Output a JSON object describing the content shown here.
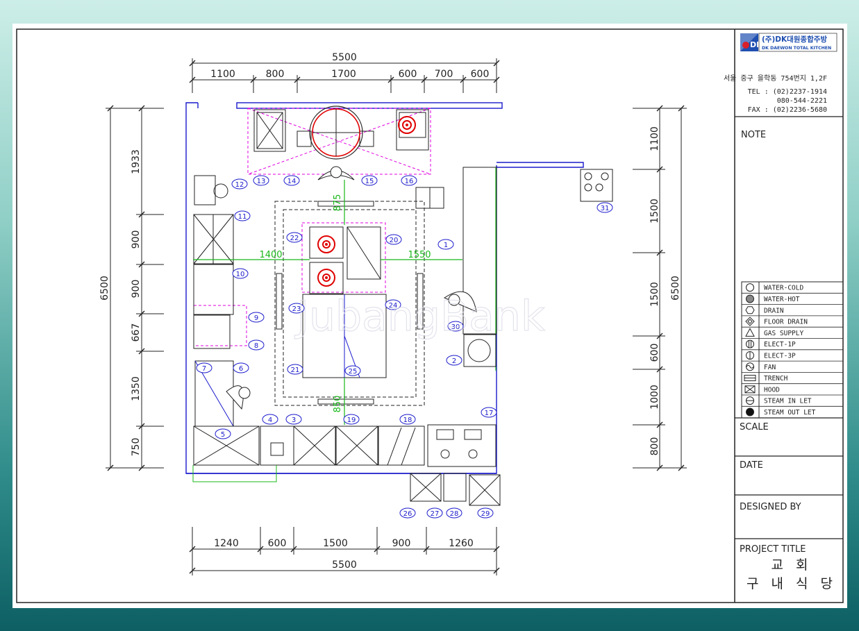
{
  "dimensions": {
    "top_total": "5500",
    "top_segments": [
      "1100",
      "800",
      "1700",
      "600",
      "700",
      "600"
    ],
    "bottom_total": "5500",
    "bottom_segments": [
      "1240",
      "600",
      "1500",
      "900",
      "1260"
    ],
    "left_total": "6500",
    "left_segments": [
      "1933",
      "900",
      "900",
      "667",
      "1350",
      "750"
    ],
    "right_total": "6500",
    "right_segments": [
      "1100",
      "1500",
      "1500",
      "600",
      "1000",
      "800"
    ],
    "inner_left": "1400",
    "inner_right": "1550",
    "inner_top": "875",
    "inner_bottom": "850"
  },
  "equipment_tags": [
    "1",
    "2",
    "3",
    "4",
    "5",
    "6",
    "7",
    "8",
    "9",
    "10",
    "11",
    "12",
    "13",
    "14",
    "15",
    "16",
    "17",
    "18",
    "19",
    "20",
    "21",
    "22",
    "23",
    "24",
    "25",
    "26",
    "27",
    "28",
    "29",
    "30",
    "31"
  ],
  "watermark": "JubangBank",
  "title_block": {
    "company_kr": "(주)DK대원종합주방",
    "company_en": "DK DAEWON TOTAL KITCHEN",
    "logo_text": "DK",
    "address": "서울 중구 을학동 754번지 1,2F",
    "tel": "TEL : (02)2237-1914",
    "tel2": "080-544-2221",
    "fax": "FAX : (02)2236-5680",
    "note_label": "NOTE",
    "scale_label": "SCALE",
    "date_label": "DATE",
    "designed_label": "DESIGNED BY",
    "project_label": "PROJECT TITLE",
    "project_line1": "교 회",
    "project_line2": "구 내 식 당"
  },
  "legend": [
    {
      "icon": "water-cold-icon",
      "label": "WATER-COLD"
    },
    {
      "icon": "water-hot-icon",
      "label": "WATER-HOT"
    },
    {
      "icon": "drain-icon",
      "label": "DRAIN"
    },
    {
      "icon": "floor-drain-icon",
      "label": "FLOOR DRAIN"
    },
    {
      "icon": "gas-supply-icon",
      "label": "GAS SUPPLY"
    },
    {
      "icon": "elect-1p-icon",
      "label": "ELECT-1P"
    },
    {
      "icon": "elect-3p-icon",
      "label": "ELECT-3P"
    },
    {
      "icon": "fan-icon",
      "label": "FAN"
    },
    {
      "icon": "trench-icon",
      "label": "TRENCH"
    },
    {
      "icon": "hood-icon",
      "label": "HOOD"
    },
    {
      "icon": "steam-inlet-icon",
      "label": "STEAM IN LET"
    },
    {
      "icon": "steam-outlet-icon",
      "label": "STEAM OUT LET"
    }
  ],
  "colors": {
    "wall": "#1a1acc",
    "hood": "#e000e0",
    "burner": "#e00000",
    "pipe": "#18b818",
    "logo_blue": "#1f4fb0",
    "logo_red": "#d8202a"
  }
}
